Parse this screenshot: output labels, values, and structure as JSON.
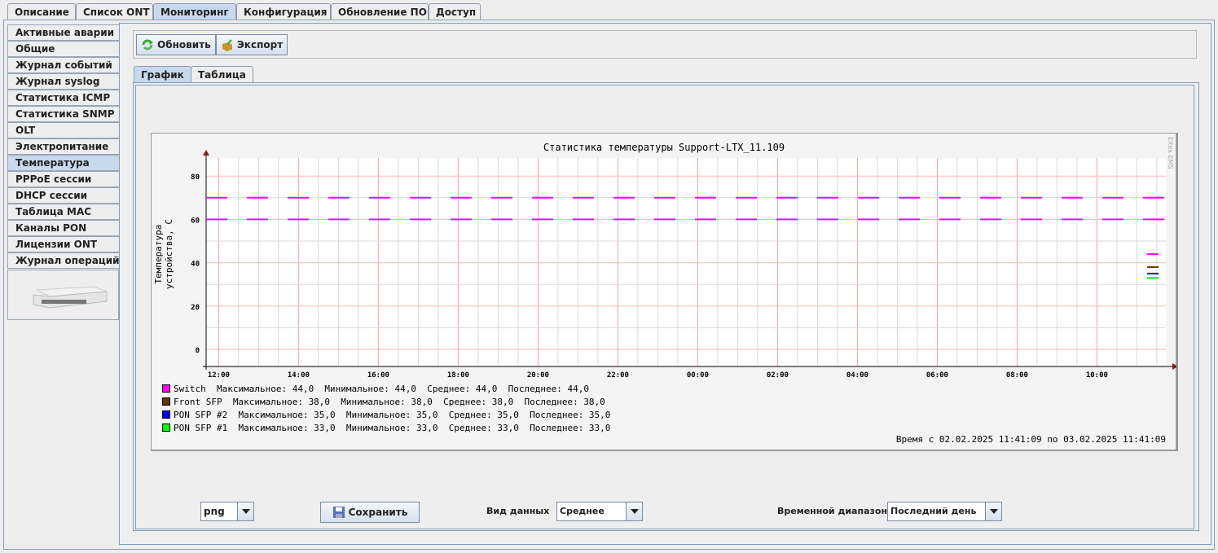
{
  "top_tabs": [
    "Описание",
    "Список ONT",
    "Мониторинг",
    "Конфигурация",
    "Обновление ПО",
    "Доступ"
  ],
  "top_tab_selected": 2,
  "sidebar": {
    "items": [
      "Активные аварии",
      "Общие",
      "Журнал событий",
      "Журнал syslog",
      "Статистика ICMP",
      "Статистика SNMP",
      "OLT",
      "Электропитание",
      "Температура",
      "PPPoE сессии",
      "DHCP сессии",
      "Таблица MAC",
      "Каналы PON",
      "Лицензии ONT",
      "Журнал операций"
    ],
    "selected": 8
  },
  "toolbar": {
    "refresh": "Обновить",
    "export": "Экспорт"
  },
  "sub_tabs": [
    "График",
    "Таблица"
  ],
  "chart_data": {
    "type": "line",
    "title": "Статистика температуры Support-LTX_11.109",
    "ylabel": "Температура устройства, C",
    "watermark": "Eltex EMS",
    "ylim": [
      -8,
      88
    ],
    "yticks": [
      0,
      20,
      40,
      60,
      80
    ],
    "xticks": [
      "12:00",
      "14:00",
      "16:00",
      "18:00",
      "20:00",
      "22:00",
      "00:00",
      "02:00",
      "04:00",
      "06:00",
      "08:00",
      "10:00"
    ],
    "thresholds": [
      70,
      60
    ],
    "series": [
      {
        "name": "Switch",
        "color": "#ff00ff",
        "last": 44,
        "legend": "Switch  Максимальное: 44,0  Минимальное: 44,0  Среднее: 44,0  Последнее: 44,0"
      },
      {
        "name": "Front SFP",
        "color": "#663300",
        "last": 38,
        "legend": "Front SFP  Максимальное: 38,0  Минимальное: 38,0  Среднее: 38,0  Последнее: 38,0"
      },
      {
        "name": "PON SFP #2",
        "color": "#0000ff",
        "last": 35,
        "legend": "PON SFP #2  Максимальное: 35,0  Минимальное: 35,0  Среднее: 35,0  Последнее: 35,0"
      },
      {
        "name": "PON SFP #1",
        "color": "#00ff00",
        "last": 33,
        "legend": "PON SFP #1  Максимальное: 33,0  Минимальное: 33,0  Среднее: 33,0  Последнее: 33,0"
      }
    ],
    "range_text": "Время с 02.02.2025 11:41:09 по 03.02.2025 11:41:09"
  },
  "bottom": {
    "format": "png",
    "save": "Сохранить",
    "data_view_label": "Вид данных",
    "data_view": "Среднее",
    "range_label": "Временной диапазон",
    "range": "Последний день"
  }
}
